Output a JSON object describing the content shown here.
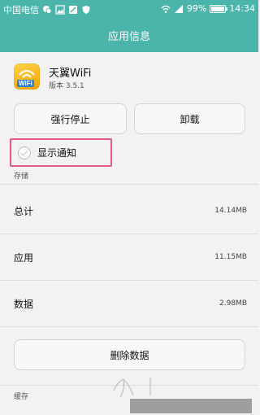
{
  "status_bar": {
    "carrier": "中国电信",
    "battery_percent": "99%",
    "battery_level": 0.99,
    "time": "14:34"
  },
  "title_bar": {
    "title": "应用信息"
  },
  "app": {
    "name": "天翼WiFi",
    "version": "版本 3.5.1",
    "icon_label": "WiFi"
  },
  "actions": {
    "force_stop_label": "强行停止",
    "uninstall_label": "卸载"
  },
  "notifications": {
    "label": "显示通知",
    "checked": true
  },
  "storage": {
    "section_title": "存储",
    "rows": [
      {
        "label": "总计",
        "value": "14.14MB"
      },
      {
        "label": "应用",
        "value": "11.15MB"
      },
      {
        "label": "数据",
        "value": "2.98MB"
      }
    ],
    "clear_data_label": "删除数据"
  },
  "cache": {
    "section_title": "缓存"
  },
  "colors": {
    "accent": "#4cb5ab",
    "highlight": "#e6568f"
  }
}
